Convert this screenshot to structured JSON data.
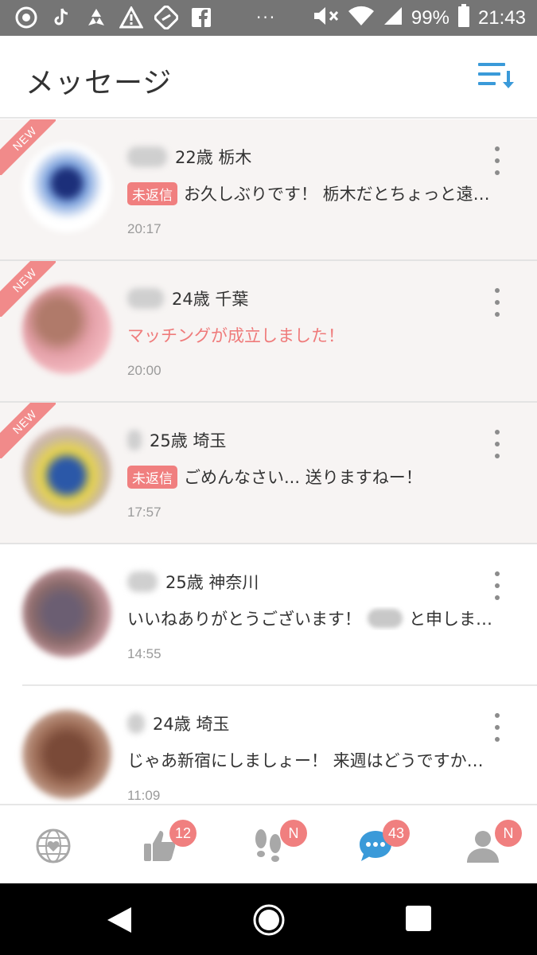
{
  "status_bar": {
    "battery": "99%",
    "time": "21:43",
    "dots": "···"
  },
  "header": {
    "title": "メッセージ"
  },
  "messages": [
    {
      "new_label": "NEW",
      "age_location": "22歳 栃木",
      "badge": "未返信",
      "preview": "お久しぶりです！ 栃木だとちょっと遠…",
      "time": "20:17"
    },
    {
      "new_label": "NEW",
      "age_location": "24歳 千葉",
      "preview": "マッチングが成立しました！",
      "time": "20:00"
    },
    {
      "new_label": "NEW",
      "age_location": "25歳 埼玉",
      "badge": "未返信",
      "preview": "ごめんなさい... 送りますねー！",
      "time": "17:57"
    },
    {
      "age_location": "25歳 神奈川",
      "preview_part1": "いいねありがとうございます！",
      "preview_part2": "と申しま…",
      "time": "14:55"
    },
    {
      "age_location": "24歳 埼玉",
      "preview": "じゃあ新宿にしましょー！ 来週はどうですか…",
      "time": "11:09"
    }
  ],
  "tabs": {
    "likes_badge": "12",
    "footprints_badge": "N",
    "messages_badge": "43",
    "profile_badge": "N"
  },
  "colors": {
    "accent_blue": "#3a9ad9",
    "badge_pink": "#f07f7f",
    "new_row_bg": "#f7f4f3"
  }
}
